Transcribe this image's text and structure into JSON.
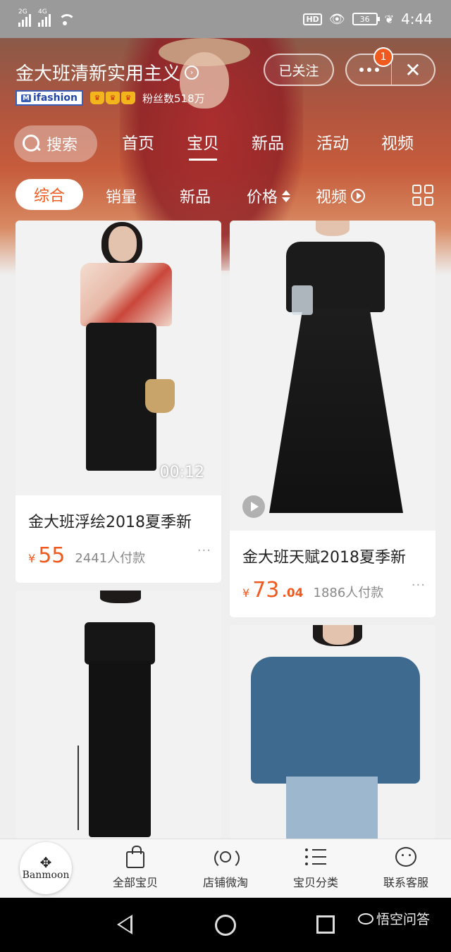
{
  "status_bar": {
    "signal1": "2G",
    "signal2": "4G",
    "hd": "HD",
    "battery": "36",
    "time": "4:44"
  },
  "shop": {
    "name": "金大班清新实用主义",
    "ifashion": "ifashion",
    "ifashion_mark": "M",
    "fans": "粉丝数518万",
    "follow_label": "已关注",
    "notification_count": "1"
  },
  "search": {
    "label": "搜索"
  },
  "tabs": [
    {
      "label": "首页"
    },
    {
      "label": "宝贝",
      "active": true
    },
    {
      "label": "新品"
    },
    {
      "label": "活动"
    },
    {
      "label": "视频"
    }
  ],
  "sort": {
    "active": "综合",
    "sales": "销量",
    "new": "新品",
    "price": "价格",
    "video": "视频"
  },
  "products": [
    {
      "title": "金大班浮绘2018夏季新",
      "currency": "¥",
      "price": "55",
      "price_decimal": "",
      "sold": "2441人付款",
      "video_time": "00:12"
    },
    {
      "title": "金大班天赋2018夏季新",
      "currency": "¥",
      "price": "73",
      "price_decimal": ".04",
      "sold": "1886人付款"
    }
  ],
  "bottom_nav": {
    "logo": "Banmoon",
    "items": [
      {
        "label": "全部宝贝",
        "icon": "bag-icon"
      },
      {
        "label": "店铺微淘",
        "icon": "broadcast-icon"
      },
      {
        "label": "宝贝分类",
        "icon": "list-icon"
      },
      {
        "label": "联系客服",
        "icon": "chat-icon"
      }
    ]
  },
  "watermark": "悟空问答",
  "colors": {
    "accent": "#f05a1e",
    "header": "#c65c3c"
  }
}
